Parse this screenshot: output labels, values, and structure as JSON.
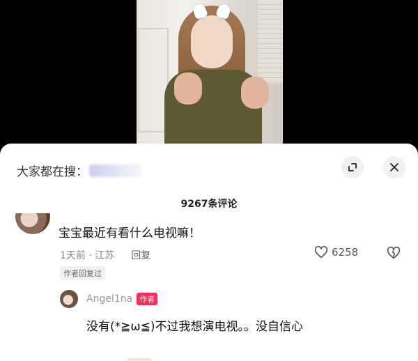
{
  "sheet": {
    "search_prefix": "大家都在搜：",
    "comment_count": "9267条评论"
  },
  "comment": {
    "text": "宝宝最近有看什么电视嘛！",
    "time_location": "1天前 · 江苏",
    "reply_label": "回复",
    "like_count": "6258",
    "author_replied_badge": "作者回复过"
  },
  "reply": {
    "username": "Angel1na",
    "author_tag": "作者",
    "text": "没有(*≧ω≦)不过我想演电视。。没自信心"
  },
  "colors": {
    "author_tag_bg": "#fe2c55",
    "sheet_bg": "#ffffff",
    "video_bg": "#000000"
  },
  "icons": {
    "expand": "expand-icon",
    "close": "close-icon",
    "like": "heart-outline-icon",
    "dislike": "broken-heart-icon"
  }
}
